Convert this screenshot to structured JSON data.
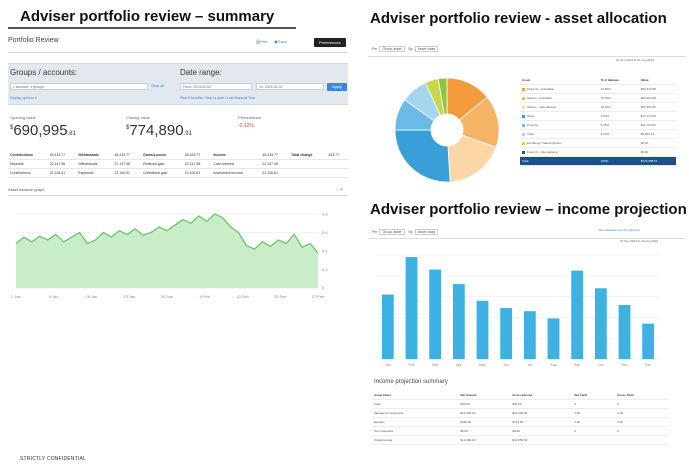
{
  "headings": {
    "summary": "Adviser portfolio review – summary",
    "allocation": "Adviser portfolio review - asset allocation",
    "income": "Adviser portfolio review – income projection"
  },
  "summary_panel": {
    "title": "Portfolio Review",
    "print_label": "Print",
    "save_label": "Save",
    "preferences_label": "Preferences",
    "groups_label": "Groups / accounts:",
    "groups_placeholder": "1 account, 1 groups",
    "clear_all": "Clear all",
    "date_range_label": "Date range:",
    "from_label": "From",
    "from_value": "2013-02-02",
    "to_label": "To",
    "to_value": "2015-02-02",
    "apply_label": "Apply",
    "display_options": "Display options",
    "presets": "Past 6 Months / Year to date / Last financial Year",
    "opening_label": "Opening value",
    "opening_main": "690,995",
    "opening_cents": ".81",
    "closing_label": "Closing value",
    "closing_main": "774,890",
    "closing_cents": ".91",
    "performance_label": "Performance",
    "performance_value": "-0.12%",
    "currency": "$",
    "fin_rows": [
      [
        "Contributions",
        "45,433.77",
        "Withdrawals",
        "45,433.77",
        "Gains/Losses",
        "45,433.77",
        "Income",
        "45,433.77",
        "Total change",
        "433.77"
      ],
      [
        "Deposits",
        "22,147.98",
        "Withdrawals",
        "22,147.98",
        "Realised gain",
        "22,147.98",
        "Cash interest",
        "22,147.98",
        "",
        ""
      ],
      [
        "Contributions",
        "22,106.61",
        "Expenses",
        "22,106.61",
        "Unrealised gain",
        "22,106.61",
        "Investment income",
        "22,106.61",
        "",
        ""
      ]
    ],
    "graph_label": "Asset balance graph",
    "x_ticks": [
      "2 Jan",
      "9 Jan",
      "16 Jan",
      "23 Jan",
      "30 Jan",
      "6 Feb",
      "13 Feb",
      "20 Feb",
      "27 Feb"
    ],
    "y_ticks": [
      "0.8",
      "0.6",
      "0.4",
      "0.2",
      "0"
    ]
  },
  "allocation_panel": {
    "period_label": "Per",
    "group_select": "Group asset",
    "by_label": "By",
    "asset_select": "Asset class",
    "date_range": "01 Sep 2014 to 01 Aug 2014",
    "table_headers": [
      "Asset",
      "% of balance",
      "Value"
    ],
    "rows": [
      {
        "name": "Fixed int - Australian",
        "pct": "13.60%",
        "value": "$93,543.68",
        "color": "#f39c3e"
      },
      {
        "name": "Shares - Australian",
        "pct": "15.70%",
        "value": "$53,353.98",
        "color": "#f7b465"
      },
      {
        "name": "Shares - International",
        "pct": "18.01%",
        "value": "$51,903.35",
        "color": "#fbd7a6"
      },
      {
        "name": "Other",
        "pct": "9.52%",
        "value": "$17,173.05",
        "color": "#3a9fd8"
      },
      {
        "name": "Property",
        "pct": "5.78%",
        "value": "$11,120.00",
        "color": "#6bbbe6"
      },
      {
        "name": "Cash",
        "pct": "5.61%",
        "value": "$6,844.01",
        "color": "#a6d5f0"
      },
      {
        "name": "Exchange Traded Options",
        "pct": "",
        "value": "$0.00",
        "color": "#c8d84a"
      },
      {
        "name": "Fixed int - International",
        "pct": "",
        "value": "$0.00",
        "color": "#1e4f86"
      }
    ],
    "total": {
      "name": "Total",
      "pct": "100%",
      "value": "$722,388.51"
    }
  },
  "income_panel": {
    "period_label": "Per",
    "group_select": "Group asset",
    "by_label": "By",
    "asset_select": "Asset class",
    "detail_link": "View detailed income projection",
    "date_range": "01 Sep 2014 to 31 Aug 2015",
    "summary_title": "Income projection summary",
    "table_headers": [
      "Asset Class",
      "Net Income",
      "Gross Income",
      "Net Yield",
      "Gross Yield"
    ],
    "rows": [
      [
        "Cash",
        "$40.00",
        "$40.00",
        "0",
        "0"
      ],
      [
        "Managed Investments",
        "$12,000.00",
        "$12,000.00",
        "3.00",
        "3.00"
      ],
      [
        "Equities",
        "$420.00",
        "$714.00",
        "2.00",
        "3.00"
      ],
      [
        "Term Deposits",
        "$0.00",
        "$0.00",
        "0",
        "0"
      ],
      [
        "Total/Average",
        "$12,460.00",
        "$12,865.00",
        "",
        ""
      ]
    ]
  },
  "chart_data": [
    {
      "type": "line",
      "title": "",
      "x": [
        "2 Jan",
        "9 Jan",
        "16 Jan",
        "23 Jan",
        "30 Jan",
        "6 Feb",
        "13 Feb",
        "20 Feb",
        "27 Feb"
      ],
      "values": [
        0.48,
        0.55,
        0.5,
        0.56,
        0.52,
        0.58,
        0.5,
        0.55,
        0.6,
        0.48,
        0.52,
        0.6,
        0.55,
        0.62,
        0.58,
        0.64,
        0.57,
        0.6,
        0.66,
        0.62,
        0.68,
        0.74,
        0.7,
        0.78,
        0.72,
        0.8,
        0.76,
        0.66,
        0.6,
        0.46,
        0.42,
        0.5,
        0.45,
        0.52,
        0.48,
        0.58,
        0.44,
        0.48,
        0.38
      ],
      "ylim": [
        0,
        0.8
      ],
      "fill": "#c9ecc9",
      "stroke": "#62c462",
      "grid": true
    },
    {
      "type": "pie",
      "donut": true,
      "labels": [
        "Fixed int - Australian",
        "Shares - Australian",
        "Shares - International",
        "Other",
        "Property",
        "Cash",
        "Exchange Traded Options",
        "Fixed int - International"
      ],
      "values": [
        13.6,
        15.7,
        18.01,
        25.0,
        9.52,
        8.0,
        4.0,
        2.6
      ],
      "colors": [
        "#f39c3e",
        "#f7b465",
        "#fbd7a6",
        "#3a9fd8",
        "#6bbbe6",
        "#a6d5f0",
        "#c8d84a",
        "#8dc63f"
      ]
    },
    {
      "type": "bar",
      "categories": [
        "Jan",
        "Feb",
        "Mar",
        "Apr",
        "May",
        "Jun",
        "Jul",
        "Aug",
        "Sep",
        "Oct",
        "Nov",
        "Dec"
      ],
      "values": [
        6.2,
        9.8,
        8.6,
        7.2,
        5.6,
        4.9,
        4.6,
        3.9,
        8.5,
        6.8,
        5.2,
        3.4
      ],
      "ylim": [
        0,
        10
      ],
      "color": "#3cb1e2"
    }
  ]
}
